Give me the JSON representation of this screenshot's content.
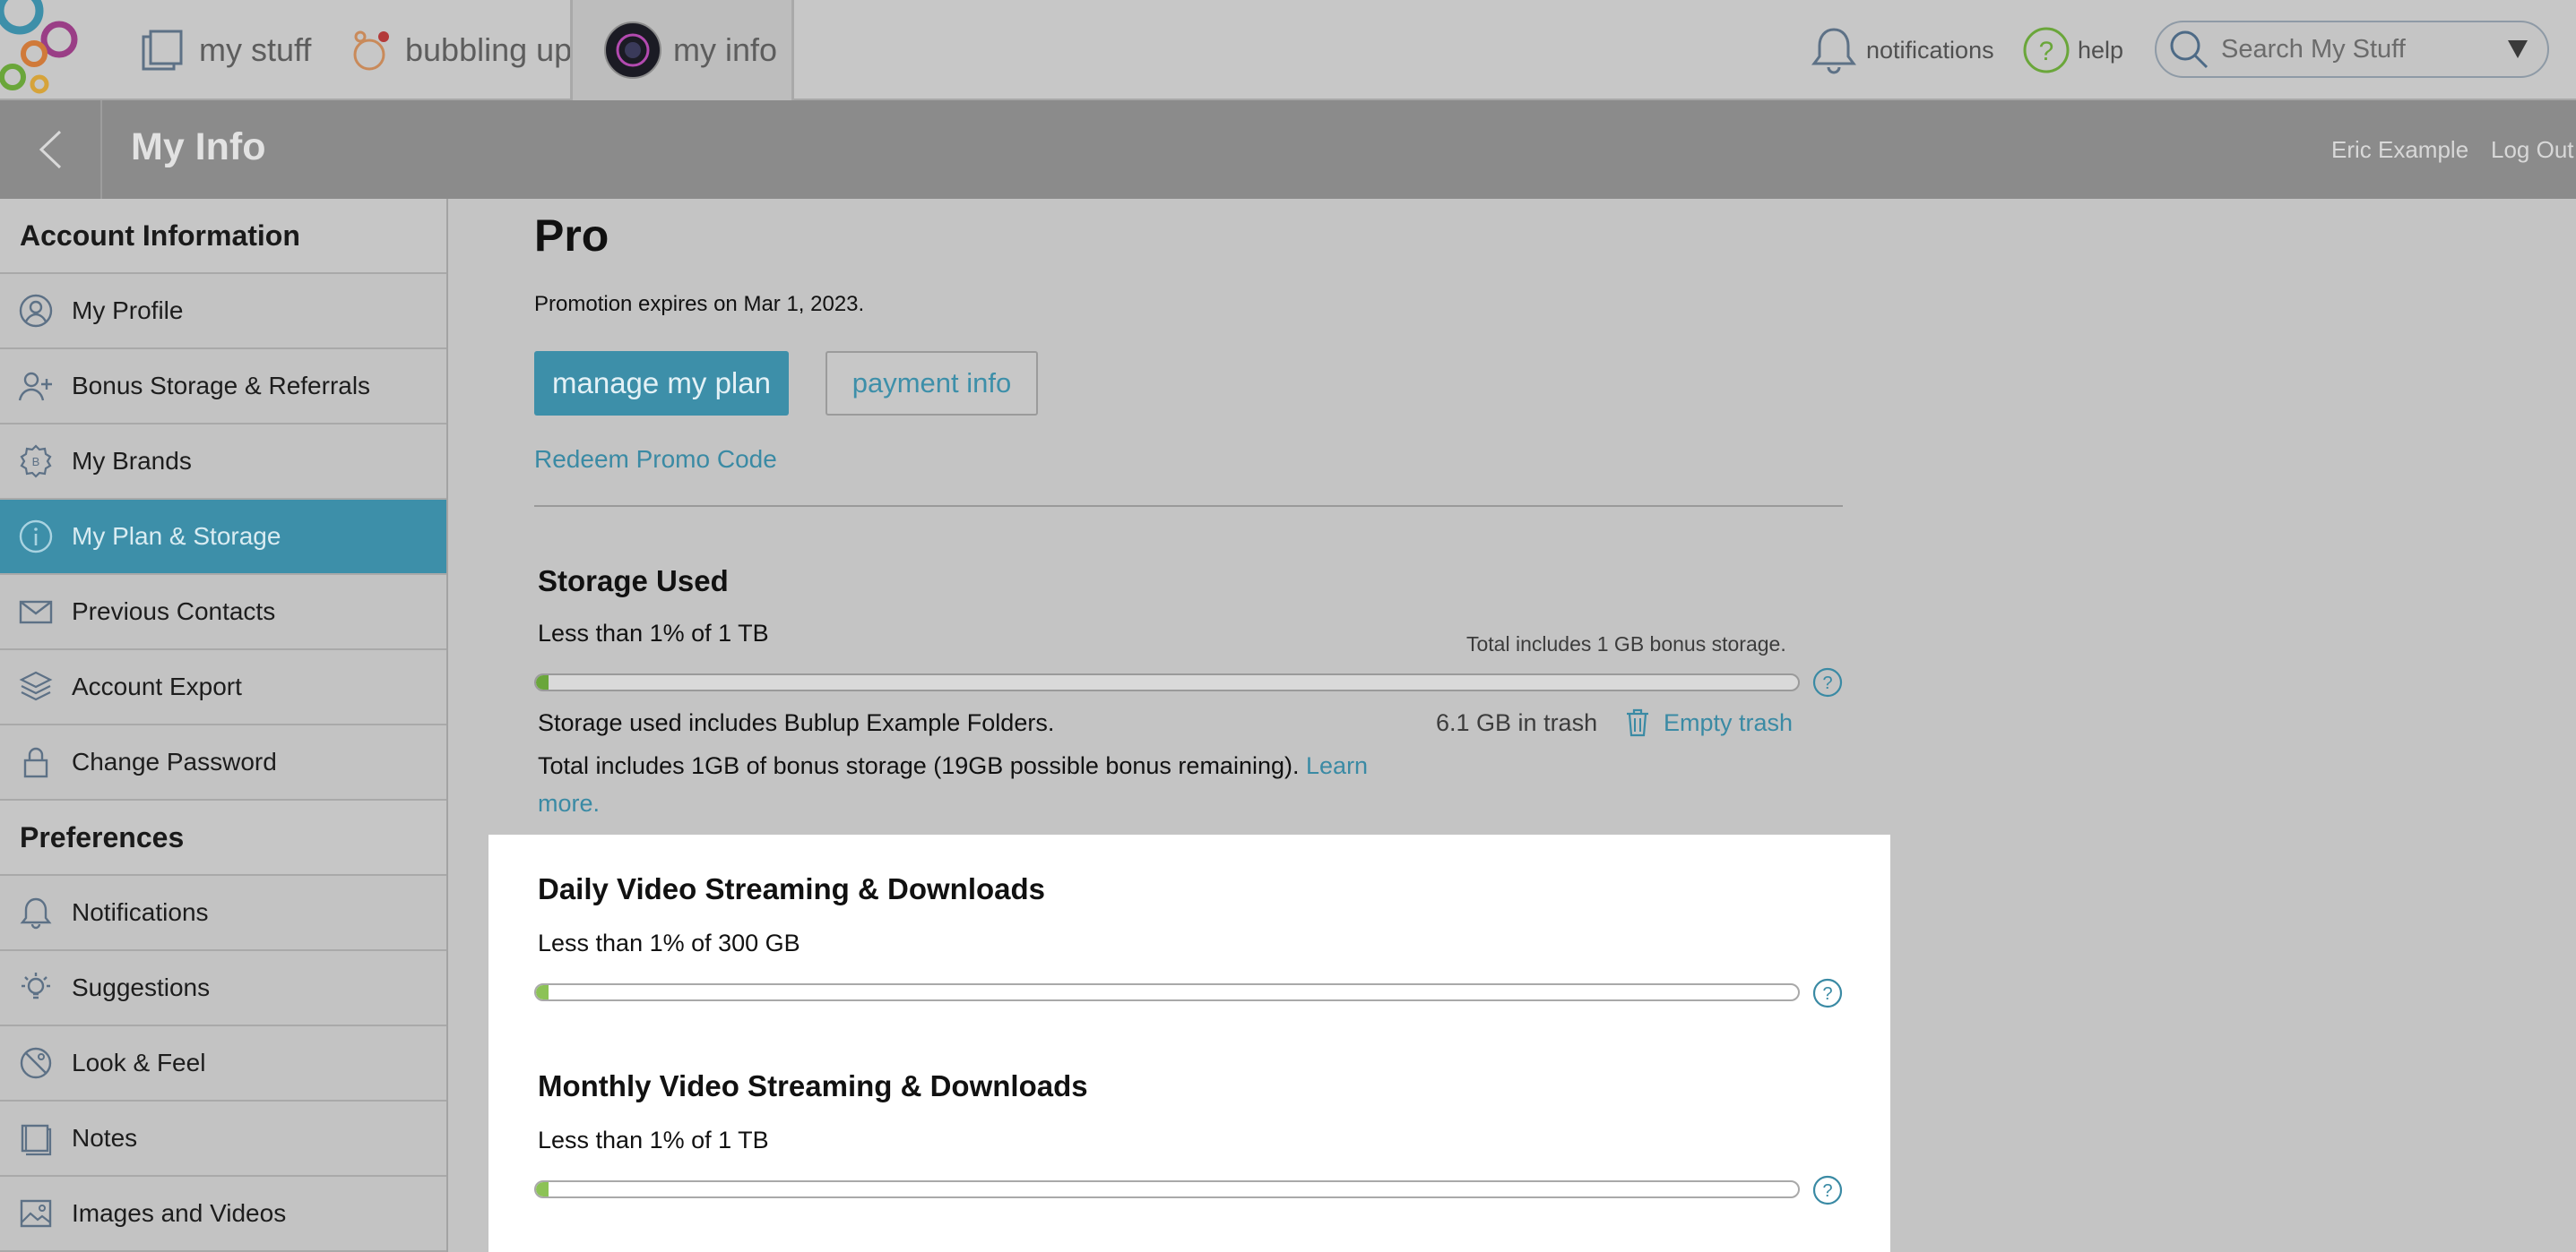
{
  "topnav": {
    "tabs": [
      {
        "label": "my stuff"
      },
      {
        "label": "bubbling up"
      },
      {
        "label": "my info"
      }
    ],
    "notifications_label": "notifications",
    "help_label": "help",
    "search_placeholder": "Search My Stuff"
  },
  "header": {
    "title": "My Info",
    "user_name": "Eric Example",
    "logout_label": "Log Out"
  },
  "sidebar": {
    "sections": [
      {
        "title": "Account Information",
        "items": [
          {
            "label": "My Profile",
            "icon": "user-icon"
          },
          {
            "label": "Bonus Storage & Referrals",
            "icon": "add-user-icon"
          },
          {
            "label": "My Brands",
            "icon": "brand-badge-icon"
          },
          {
            "label": "My Plan & Storage",
            "icon": "info-icon",
            "active": true
          },
          {
            "label": "Previous Contacts",
            "icon": "envelope-icon"
          },
          {
            "label": "Account Export",
            "icon": "layers-icon"
          },
          {
            "label": "Change Password",
            "icon": "lock-icon"
          }
        ]
      },
      {
        "title": "Preferences",
        "items": [
          {
            "label": "Notifications",
            "icon": "bell-icon"
          },
          {
            "label": "Suggestions",
            "icon": "lightbulb-icon"
          },
          {
            "label": "Look & Feel",
            "icon": "palette-icon"
          },
          {
            "label": "Notes",
            "icon": "notebook-icon"
          },
          {
            "label": "Images and Videos",
            "icon": "image-icon"
          }
        ]
      }
    ]
  },
  "plan": {
    "name": "Pro",
    "promotion": "Promotion expires on Mar 1, 2023.",
    "manage_button": "manage my plan",
    "payment_button": "payment info",
    "redeem_link": "Redeem Promo Code"
  },
  "storage": {
    "title": "Storage Used",
    "usage_text": "Less than 1% of 1 TB",
    "bonus_note": "Total includes 1 GB bonus storage.",
    "fraction_used": 0.01,
    "includes_text": "Storage used includes Bublup Example Folders.",
    "bonus_text": "Total includes 1GB of bonus storage (19GB possible bonus remaining).",
    "learn_more": "Learn more.",
    "trash_text": "6.1 GB in trash",
    "empty_trash": "Empty trash"
  },
  "daily_streaming": {
    "title": "Daily Video Streaming & Downloads",
    "usage_text": "Less than 1% of 300 GB",
    "fraction_used": 0.01
  },
  "monthly_streaming": {
    "title": "Monthly Video Streaming & Downloads",
    "usage_text": "Less than 1% of 1 TB",
    "fraction_used": 0.01
  },
  "colors": {
    "accent": "#3d8fa9",
    "progress_fill": "#6aa63a",
    "overlay_gray": "#c4c4c4"
  }
}
